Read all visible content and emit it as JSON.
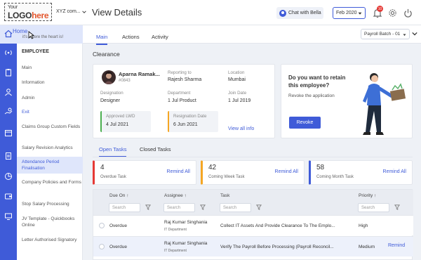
{
  "header": {
    "logo": {
      "your": "Your",
      "word_a": "LOGO",
      "word_b": "here"
    },
    "company": "XYZ com...",
    "page_title": "View Details",
    "chat_label": "Chat with Bella",
    "period": "Feb 2020",
    "notifications": "10"
  },
  "sidebar": {
    "home": {
      "label": "Home",
      "tagline": "it's where the heart is!"
    },
    "section": "EMPLOYEE",
    "items": [
      {
        "label": "Main"
      },
      {
        "label": "Information"
      },
      {
        "label": "Admin"
      },
      {
        "label": "Exit"
      },
      {
        "label": "Claims Group Custom Fields"
      },
      {
        "label": "Salary Revision Analytics"
      },
      {
        "label": "Attendance Period Finalisation"
      },
      {
        "label": "Company Policies and Forms"
      },
      {
        "label": "Stop Salary Processing"
      },
      {
        "label": "JV Template - Quickbooks Online"
      },
      {
        "label": "Letter Authorised Signatory"
      }
    ]
  },
  "tabs": [
    {
      "label": "Main"
    },
    {
      "label": "Actions"
    },
    {
      "label": "Activity"
    }
  ],
  "batch": "Payroll Batch - 01",
  "clearance": {
    "title": "Clearance",
    "employee": {
      "name": "Aparna Ramak...",
      "id": "#0843"
    },
    "reporting_label": "Reporting to",
    "reporting_value": "Rajesh Sharma",
    "location_label": "Location",
    "location_value": "Mumbai",
    "designation_label": "Designation",
    "designation_value": "Designer",
    "department_label": "Department",
    "department_value": "1 Jul Product",
    "join_label": "Join Date",
    "join_value": "1 Jul 2019",
    "lwd_label": "Approved LWD",
    "lwd_value": "4 Jul 2021",
    "resign_label": "Resignation Date",
    "resign_value": "6 Jun 2021",
    "view_all": "View all info"
  },
  "retain": {
    "question": "Do you want to retain this employee?",
    "subtext": "Revoke the application",
    "button": "Revoke"
  },
  "task_tabs": [
    {
      "label": "Open Tasks"
    },
    {
      "label": "Closed Tasks"
    }
  ],
  "stats": [
    {
      "count": "4",
      "label": "Overdue Task",
      "action": "Remind All",
      "color": "#e53935"
    },
    {
      "count": "42",
      "label": "Coming Week Task",
      "action": "Remind All",
      "color": "#f5a623"
    },
    {
      "count": "58",
      "label": "Coming Month Task",
      "action": "Remind All",
      "color": "#3f5bd8"
    }
  ],
  "table": {
    "headers": {
      "due": "Due On",
      "assignee": "Assignee",
      "task": "Task",
      "priority": "Priority"
    },
    "search_placeholder": "Search",
    "rows": [
      {
        "due": "Overdue",
        "assignee": "Raj Kumar Singhania",
        "dept": "IT Department",
        "task": "Collect IT Assets And Provide Clearance To The Emplo...",
        "priority": "High",
        "action": ""
      },
      {
        "due": "Overdue",
        "assignee": "Raj Kumar Singhania",
        "dept": "IT Department",
        "task": "Verify The Payroll Before Processing (Payroll Reconcil...",
        "priority": "Medium",
        "action": "Remind"
      }
    ]
  },
  "colors": {
    "accent": "#3f5bd8",
    "danger": "#e53935",
    "warning": "#f5a623",
    "success": "#4caf50"
  }
}
